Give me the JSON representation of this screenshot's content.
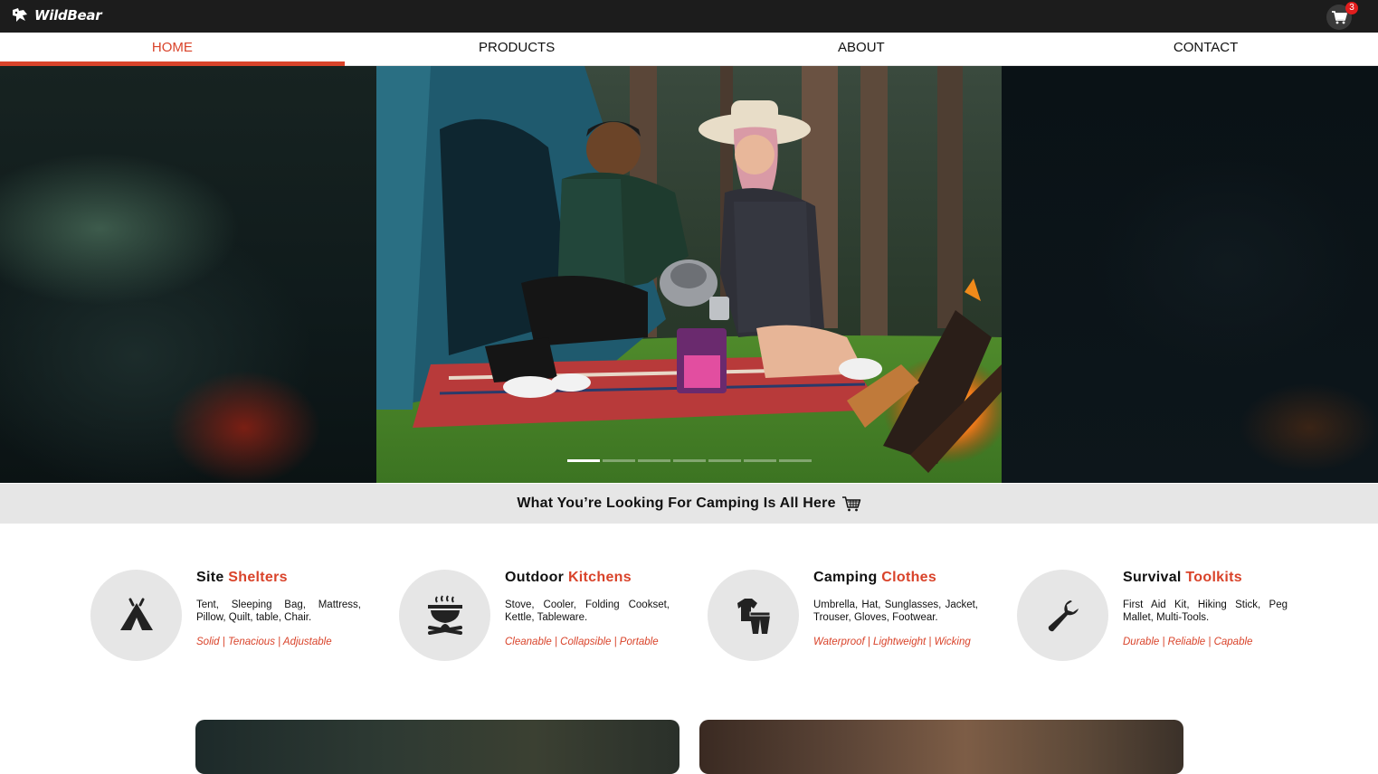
{
  "brand": {
    "name": "WildBear"
  },
  "cart": {
    "count": "3"
  },
  "nav": {
    "tabs": [
      {
        "label": "HOME",
        "active": true
      },
      {
        "label": "PRODUCTS",
        "active": false
      },
      {
        "label": "ABOUT",
        "active": false
      },
      {
        "label": "CONTACT",
        "active": false
      }
    ]
  },
  "hero": {
    "slide_count": 7,
    "active_slide": 1
  },
  "banner": {
    "text": "What You’re Looking For Camping Is All Here"
  },
  "categories": [
    {
      "title_plain": "Site ",
      "title_accent": "Shelters",
      "description": "Tent, Sleeping Bag, Mattress, Pillow, Quilt, table, Chair.",
      "tags": "Solid | Tenacious | Adjustable",
      "icon": "tent-icon"
    },
    {
      "title_plain": "Outdoor ",
      "title_accent": "Kitchens",
      "description": "Stove, Cooler, Folding Cookset, Kettle, Tableware.",
      "tags": "Cleanable | Collapsible | Portable",
      "icon": "campfire-pot-icon"
    },
    {
      "title_plain": "Camping ",
      "title_accent": "Clothes",
      "description": "Umbrella, Hat, Sunglasses, Jacket, Trouser, Gloves, Footwear.",
      "tags": "Waterproof | Lightweight | Wicking",
      "icon": "clothes-icon"
    },
    {
      "title_plain": "Survival ",
      "title_accent": "Toolkits",
      "description": "First Aid Kit, Hiking Stick, Peg Mallet, Multi-Tools.",
      "tags": "Durable | Reliable | Capable",
      "icon": "wrench-icon"
    }
  ],
  "colors": {
    "accent": "#d9432a",
    "topbar": "#1c1c1c",
    "banner_bg": "#e6e6e6",
    "icon_circle": "#e6e6e6"
  }
}
